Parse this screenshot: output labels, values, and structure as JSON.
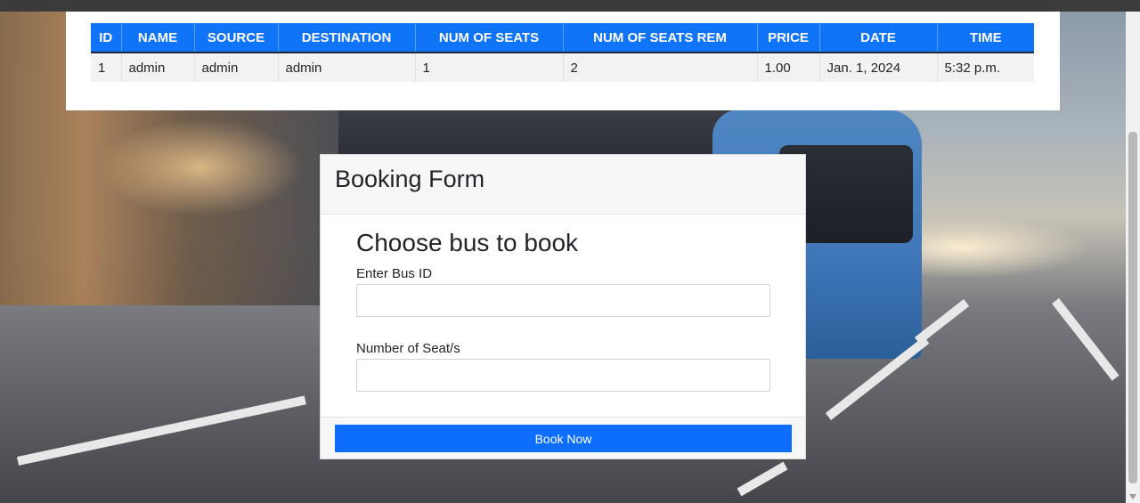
{
  "table": {
    "headers": [
      "ID",
      "NAME",
      "SOURCE",
      "DESTINATION",
      "NUM OF SEATS",
      "NUM OF SEATS REM",
      "PRICE",
      "DATE",
      "TIME"
    ],
    "rows": [
      [
        "1",
        "admin",
        "admin",
        "admin",
        "1",
        "2",
        "1.00",
        "Jan. 1, 2024",
        "5:32 p.m."
      ]
    ]
  },
  "form": {
    "header_title": "Booking Form",
    "subtitle": "Choose bus to book",
    "bus_id_label": "Enter Bus ID",
    "bus_id_value": "",
    "seats_label": "Number of Seat/s",
    "seats_value": "",
    "submit_label": "Book Now"
  },
  "colors": {
    "accent": "#0d6efd",
    "table_header": "#1074f8"
  }
}
